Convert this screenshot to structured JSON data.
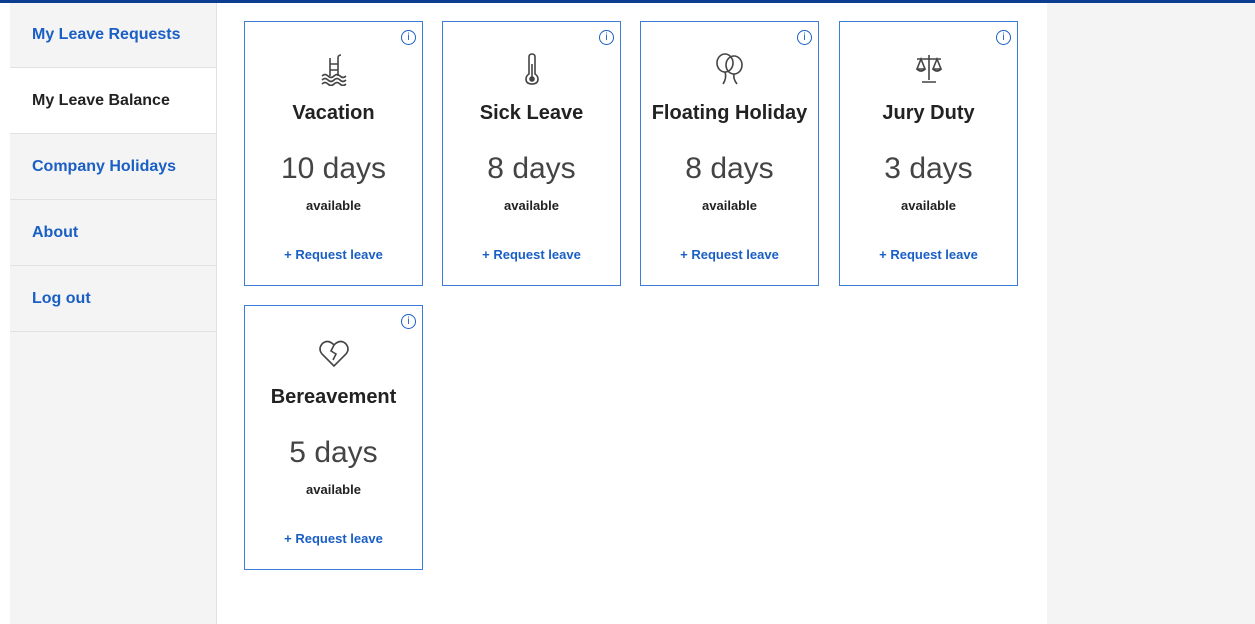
{
  "nav": {
    "items": [
      {
        "label": "My Leave Requests"
      },
      {
        "label": "My Leave Balance"
      },
      {
        "label": "Company Holidays"
      },
      {
        "label": "About"
      },
      {
        "label": "Log out"
      }
    ]
  },
  "cards": [
    {
      "title": "Vacation",
      "days": "10 days",
      "available": "available",
      "action": "+ Request leave",
      "icon": "pool-icon"
    },
    {
      "title": "Sick Leave",
      "days": "8 days",
      "available": "available",
      "action": "+ Request leave",
      "icon": "thermometer-icon"
    },
    {
      "title": "Floating Holiday",
      "days": "8 days",
      "available": "available",
      "action": "+ Request leave",
      "icon": "balloons-icon"
    },
    {
      "title": "Jury Duty",
      "days": "3 days",
      "available": "available",
      "action": "+ Request leave",
      "icon": "scales-icon"
    },
    {
      "title": "Bereavement",
      "days": "5 days",
      "available": "available",
      "action": "+ Request leave",
      "icon": "broken-heart-icon"
    }
  ],
  "colors": {
    "accent": "#1a5fc4",
    "border": "#3b7dd8",
    "topbar": "#0b3d91"
  }
}
